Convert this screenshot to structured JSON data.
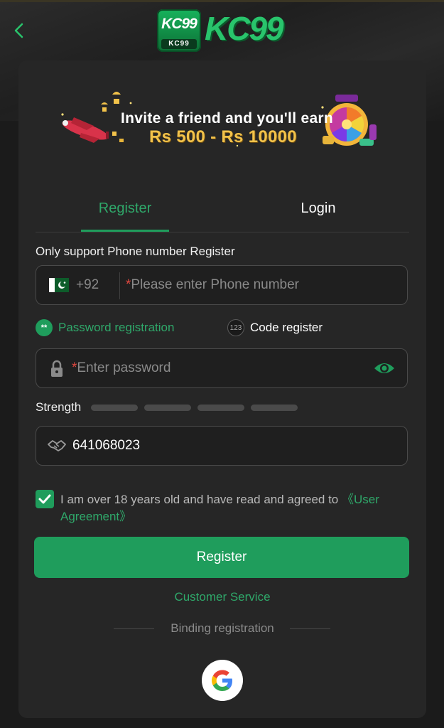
{
  "header": {
    "logo_badge_text": "KC99",
    "logo_badge_small": "KC99",
    "logo_text": "KC99"
  },
  "banner": {
    "line1": "Invite a friend and you'll earn",
    "line2": "Rs 500 - Rs 10000",
    "spin_label": "SPIN"
  },
  "tabs": [
    {
      "label": "Register",
      "active": true
    },
    {
      "label": "Login",
      "active": false
    }
  ],
  "phone": {
    "label": "Only support Phone number Register",
    "country_code": "+92",
    "required_mark": "*",
    "placeholder": "Please enter Phone number"
  },
  "reg_modes": {
    "password": {
      "icon_text": "**",
      "label": "Password registration",
      "selected": true
    },
    "code": {
      "icon_text": "123",
      "label": "Code register",
      "selected": false
    }
  },
  "password": {
    "required_mark": "*",
    "placeholder": "Enter password"
  },
  "strength": {
    "label": "Strength",
    "level": 0,
    "segments": 4
  },
  "invite_code": {
    "value": "641068023"
  },
  "agreement": {
    "checked": true,
    "text": "I am over 18 years old and have read and agreed to ",
    "link": "《User Agreement》"
  },
  "actions": {
    "register_button": "Register",
    "customer_service": "Customer Service",
    "binding_registration": "Binding registration"
  },
  "colors": {
    "accent": "#1f9d5c",
    "accent_text": "#2fa86a",
    "background": "#1b1b1b",
    "card": "#262626",
    "required": "#e0473f"
  },
  "icons": [
    "chevron-left-icon",
    "lock-icon",
    "eye-icon",
    "handshake-icon",
    "checkmark-icon",
    "google-icon",
    "pakistan-flag-icon"
  ]
}
